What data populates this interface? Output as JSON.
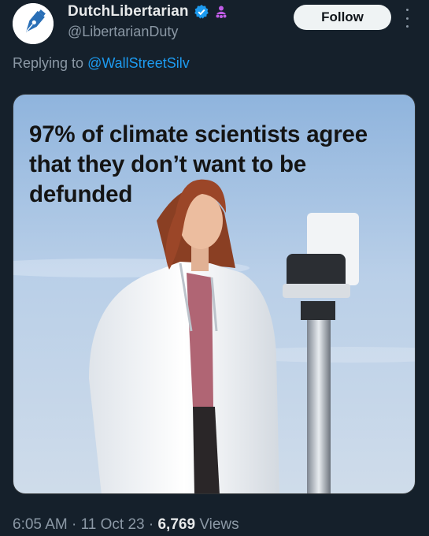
{
  "author": {
    "display_name": "DutchLibertarian",
    "handle": "@LibertarianDuty",
    "verified_icon": "verified-badge-icon",
    "affiliate_icon": "affiliate-people-icon",
    "avatar_icon": "pen-nib-logo-icon"
  },
  "actions": {
    "follow_label": "Follow",
    "more_icon": "more-vertical-icon"
  },
  "reply": {
    "prefix": "Replying to",
    "mention": "@WallStreetSilv"
  },
  "media": {
    "caption": "97% of climate scientists agree that they don’t want to be defunded"
  },
  "meta": {
    "time": "6:05 AM",
    "separator": "·",
    "date": "11 Oct 23",
    "views_count": "6,769",
    "views_label": "Views"
  },
  "colors": {
    "background": "#15202b",
    "accent": "#1d9bf0",
    "muted": "#8b98a5",
    "affiliate": "#c05ce6"
  }
}
